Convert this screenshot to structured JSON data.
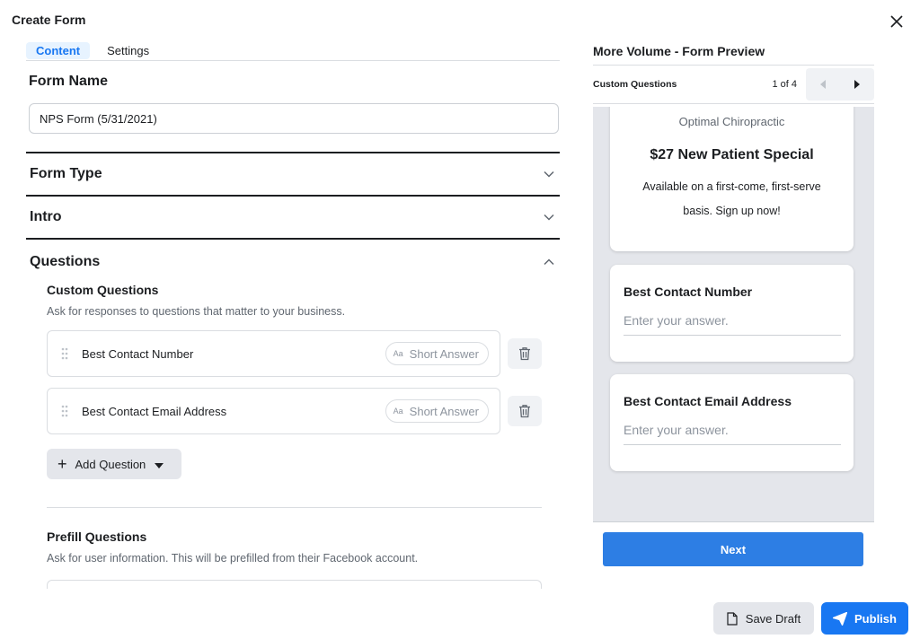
{
  "dialog": {
    "title": "Create Form",
    "close_icon": "close-icon"
  },
  "tabs": [
    {
      "label": "Content",
      "active": true
    },
    {
      "label": "Settings",
      "active": false
    }
  ],
  "form_name": {
    "label": "Form Name",
    "value": "NPS Form (5/31/2021)"
  },
  "sections": {
    "form_type": "Form Type",
    "intro": "Intro",
    "questions": "Questions"
  },
  "custom_questions": {
    "title": "Custom Questions",
    "description": "Ask for responses to questions that matter to your business.",
    "items": [
      {
        "label": "Best Contact Number",
        "type": "Short Answer",
        "type_icon": "Aa"
      },
      {
        "label": "Best Contact Email Address",
        "type": "Short Answer",
        "type_icon": "Aa"
      }
    ],
    "add_label": "Add Question"
  },
  "prefill": {
    "title": "Prefill Questions",
    "description": "Ask for user information. This will be prefilled from their Facebook account."
  },
  "preview": {
    "title": "More Volume - Form Preview",
    "section": "Custom Questions",
    "page": "1 of 4",
    "business": "Optimal Chiropractic",
    "headline": "$27 New Patient Special",
    "description": "Available on a first-come, first-serve basis. Sign up now!",
    "questions": [
      {
        "label": "Best Contact Number",
        "placeholder": "Enter your answer."
      },
      {
        "label": "Best Contact Email Address",
        "placeholder": "Enter your answer."
      }
    ],
    "next_label": "Next"
  },
  "footer": {
    "save_label": "Save Draft",
    "publish_label": "Publish"
  },
  "colors": {
    "accent": "#1877f2",
    "preview_bg": "#e4e6eb",
    "next_button": "#2d7ee4"
  }
}
